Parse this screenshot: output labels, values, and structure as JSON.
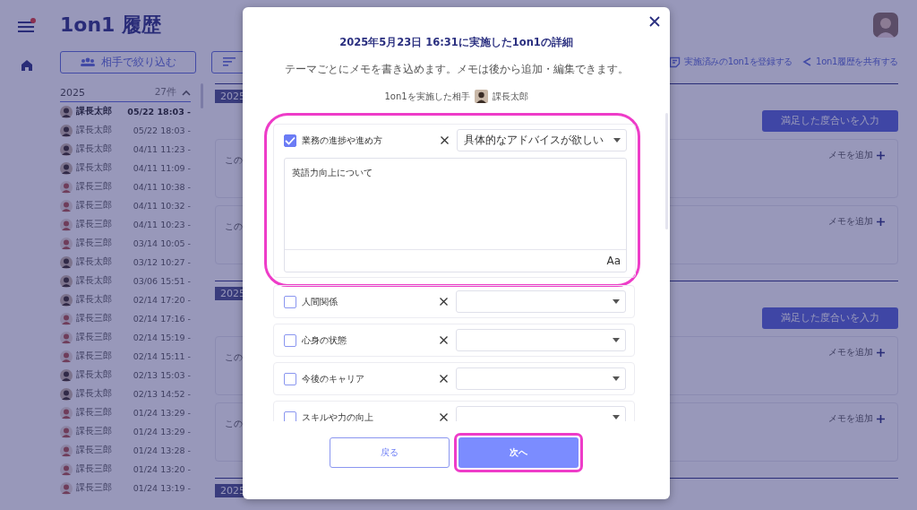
{
  "header": {
    "title": "1on1 履歴"
  },
  "toolbar": {
    "filter_button": "相手で絞り込む",
    "actions": [
      {
        "kind": "register",
        "label": "実施済みの1on1を登録する"
      },
      {
        "kind": "share",
        "label": "1on1履歴を共有する"
      }
    ]
  },
  "history": {
    "year": "2025",
    "count": "27件",
    "expanded": true,
    "rows": [
      {
        "name": "課長太郎",
        "time": "05/22 18:03 -",
        "kind": "dark",
        "selected": true
      },
      {
        "name": "課長太郎",
        "time": "05/22 18:03 -",
        "kind": "dark",
        "selected": false
      },
      {
        "name": "課長太郎",
        "time": "04/11 11:23 -",
        "kind": "dark",
        "selected": false
      },
      {
        "name": "課長太郎",
        "time": "04/11 11:09 -",
        "kind": "dark",
        "selected": false
      },
      {
        "name": "課長三郎",
        "time": "04/11 10:38 -",
        "kind": "light",
        "selected": false
      },
      {
        "name": "課長三郎",
        "time": "04/11 10:32 -",
        "kind": "light",
        "selected": false
      },
      {
        "name": "課長三郎",
        "time": "04/11 10:23 -",
        "kind": "light",
        "selected": false
      },
      {
        "name": "課長三郎",
        "time": "03/14 10:05 -",
        "kind": "light",
        "selected": false
      },
      {
        "name": "課長太郎",
        "time": "03/12 10:27 -",
        "kind": "dark",
        "selected": false
      },
      {
        "name": "課長太郎",
        "time": "03/06 15:51 -",
        "kind": "dark",
        "selected": false
      },
      {
        "name": "課長太郎",
        "time": "02/14 17:20 -",
        "kind": "dark",
        "selected": false
      },
      {
        "name": "課長三郎",
        "time": "02/14 17:16 -",
        "kind": "light",
        "selected": false
      },
      {
        "name": "課長三郎",
        "time": "02/14 15:19 -",
        "kind": "light",
        "selected": false
      },
      {
        "name": "課長三郎",
        "time": "02/14 15:11 -",
        "kind": "light",
        "selected": false
      },
      {
        "name": "課長太郎",
        "time": "02/13 15:03 -",
        "kind": "dark",
        "selected": false
      },
      {
        "name": "課長太郎",
        "time": "02/13 14:52 -",
        "kind": "dark",
        "selected": false
      },
      {
        "name": "課長三郎",
        "time": "01/24 13:29 -",
        "kind": "light",
        "selected": false
      },
      {
        "name": "課長三郎",
        "time": "01/24 13:29 -",
        "kind": "light",
        "selected": false
      },
      {
        "name": "課長三郎",
        "time": "01/24 13:28 -",
        "kind": "light",
        "selected": false
      },
      {
        "name": "課長三郎",
        "time": "01/24 13:20 -",
        "kind": "light",
        "selected": false
      },
      {
        "name": "課長三郎",
        "time": "01/24 13:19 -",
        "kind": "light",
        "selected": false
      }
    ]
  },
  "sections": [
    {
      "tag": "2025",
      "rate_button": "満足した度合いを入力",
      "cards": [
        {
          "text": "この",
          "add_memo": "メモを追加"
        },
        {
          "text": "この",
          "add_memo": "メモを追加"
        }
      ]
    },
    {
      "tag": "2025",
      "rate_button": "満足した度合いを入力",
      "cards": [
        {
          "text": "この",
          "add_memo": "メモを追加"
        },
        {
          "text": "この",
          "add_memo": "メモを追加"
        }
      ]
    },
    {
      "tag": "2025"
    }
  ],
  "modal": {
    "title": "2025年5月23日 16:31に実施した1on1の詳細",
    "subtitle": "テーマごとにメモを書き込めます。メモは後から追加・編集できます。",
    "partner_label": "1on1を実施した相手",
    "partner_name": "課長太郎",
    "themes": [
      {
        "label": "業務の進捗や進め方",
        "checked": true,
        "value": "具体的なアドバイスが欲しい",
        "memo": "英語力向上について",
        "format_label": "Aa",
        "highlighted": true
      },
      {
        "label": "人間関係",
        "checked": false,
        "highlighted": false
      },
      {
        "label": "心身の状態",
        "checked": false,
        "highlighted": false
      },
      {
        "label": "今後のキャリア",
        "checked": false,
        "highlighted": false
      },
      {
        "label": "スキルや力の向上",
        "checked": false,
        "highlighted": false
      }
    ],
    "back_button": {
      "label": "戻る"
    },
    "next_button": {
      "label": "次へ",
      "highlighted": true
    }
  }
}
